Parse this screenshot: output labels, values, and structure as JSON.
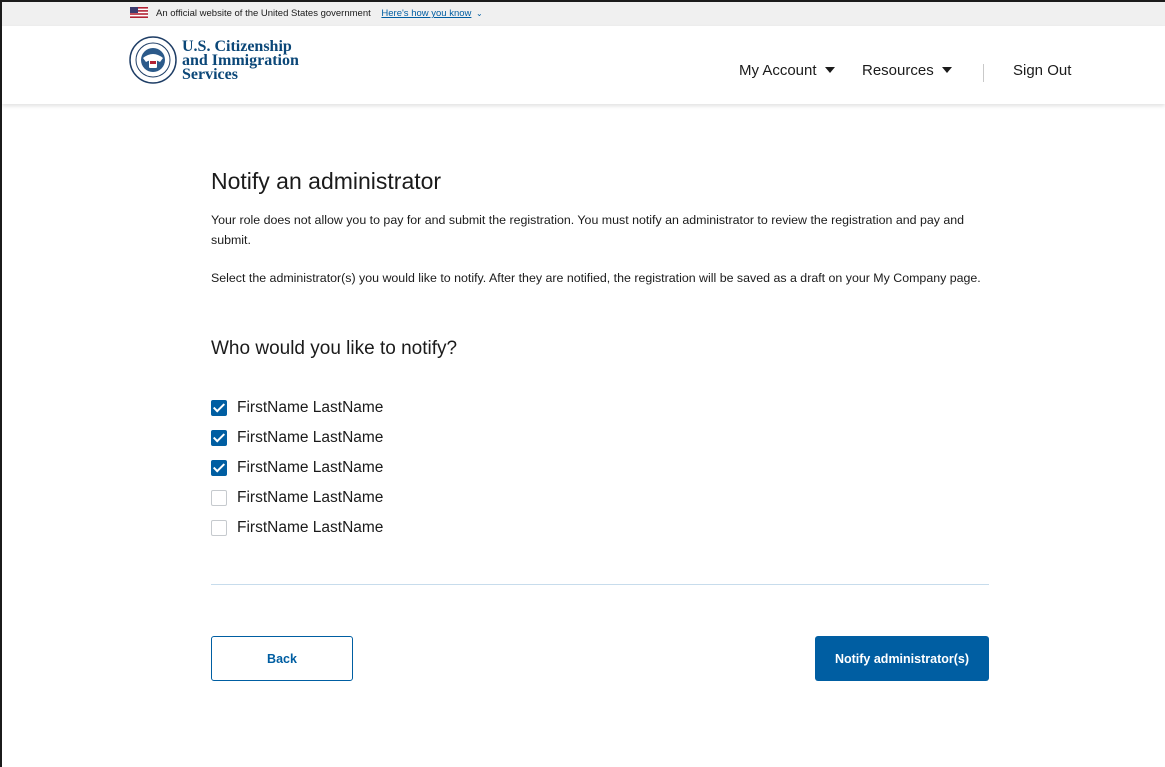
{
  "gov_banner": {
    "text": "An official website of the United States government",
    "link": "Here's how you know",
    "icon": "chevron-down-icon"
  },
  "header": {
    "agency_lines": [
      "U.S. Citizenship",
      "and Immigration",
      "Services"
    ],
    "nav": {
      "my_account": "My Account",
      "resources": "Resources",
      "sign_out": "Sign Out"
    }
  },
  "main": {
    "title": "Notify an administrator",
    "paragraph1": "Your role does not allow you to pay for and submit the registration. You must notify an administrator to review the registration and pay and submit.",
    "paragraph2": "Select the administrator(s) you would like to notify. After they are notified, the registration will be saved as a draft on your My Company page.",
    "question": "Who would you like to notify?",
    "administrators": [
      {
        "label": "FirstName LastName",
        "checked": true
      },
      {
        "label": "FirstName LastName",
        "checked": true
      },
      {
        "label": "FirstName LastName",
        "checked": true
      },
      {
        "label": "FirstName LastName",
        "checked": false
      },
      {
        "label": "FirstName LastName",
        "checked": false
      }
    ]
  },
  "actions": {
    "back": "Back",
    "notify": "Notify administrator(s)"
  },
  "colors": {
    "primary": "#005ea2",
    "agency_text": "#0b4778",
    "banner_bg": "#f0f0f0"
  }
}
